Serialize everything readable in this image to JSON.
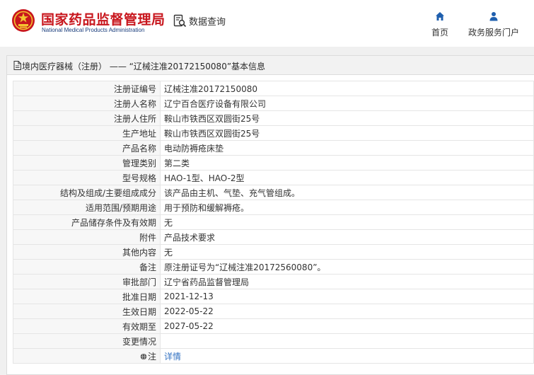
{
  "header": {
    "agency_cn": "国家药品监督管理局",
    "agency_en": "National Medical Products Administration",
    "query_label": "数据查询",
    "nav_home": "首页",
    "nav_affairs": "政务服务门户"
  },
  "panel": {
    "title": "境内医疗器械（注册） —— “辽械注准20172150080”基本信息"
  },
  "rows": [
    {
      "label": "注册证编号",
      "value": "辽械注准20172150080"
    },
    {
      "label": "注册人名称",
      "value": "辽宁百合医疗设备有限公司"
    },
    {
      "label": "注册人住所",
      "value": "鞍山市铁西区双圆街25号"
    },
    {
      "label": "生产地址",
      "value": "鞍山市铁西区双圆街25号"
    },
    {
      "label": "产品名称",
      "value": "电动防褥疮床垫"
    },
    {
      "label": "管理类别",
      "value": "第二类"
    },
    {
      "label": "型号规格",
      "value": "HAO-1型、HAO-2型"
    },
    {
      "label": "结构及组成/主要组成成分",
      "value": "该产品由主机、气垫、充气管组成。"
    },
    {
      "label": "适用范围/预期用途",
      "value": "用于预防和缓解褥疮。"
    },
    {
      "label": "产品储存条件及有效期",
      "value": "无"
    },
    {
      "label": "附件",
      "value": "产品技术要求"
    },
    {
      "label": "其他内容",
      "value": "无"
    },
    {
      "label": "备注",
      "value": "原注册证号为“辽械注准20172560080”。"
    },
    {
      "label": "审批部门",
      "value": "辽宁省药品监督管理局"
    },
    {
      "label": "批准日期",
      "value": "2021-12-13"
    },
    {
      "label": "生效日期",
      "value": "2022-05-22"
    },
    {
      "label": "有效期至",
      "value": "2027-05-22"
    },
    {
      "label": "变更情况",
      "value": ""
    },
    {
      "label": "注",
      "value": "详情"
    }
  ],
  "colors": {
    "brand_red": "#c8161d",
    "nav_blue": "#1f5fae",
    "link_blue": "#3372c2"
  },
  "icons": {
    "logo": "national-emblem-icon",
    "query": "search-document-icon",
    "home": "home-icon",
    "affairs": "user-icon",
    "title": "document-icon",
    "note": "globe-icon"
  }
}
